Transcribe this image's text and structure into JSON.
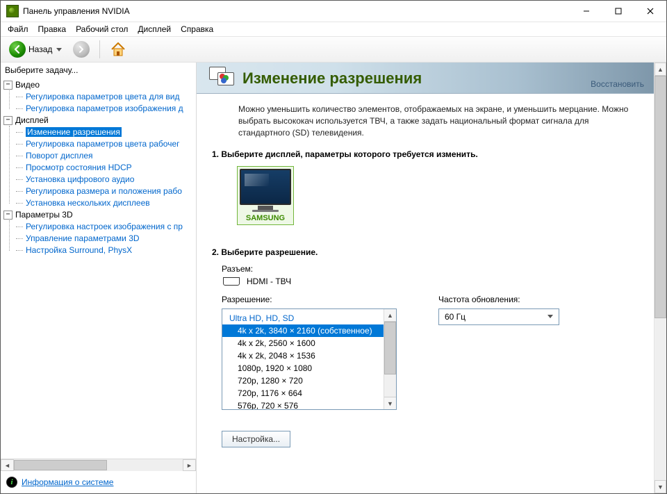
{
  "window": {
    "title": "Панель управления NVIDIA"
  },
  "menu": {
    "file": "Файл",
    "edit": "Правка",
    "desktop": "Рабочий стол",
    "display": "Дисплей",
    "help": "Справка"
  },
  "toolbar": {
    "back": "Назад"
  },
  "sidebar": {
    "header": "Выберите задачу...",
    "groups": [
      {
        "label": "Видео",
        "items": [
          "Регулировка параметров цвета для вид",
          "Регулировка параметров изображения д"
        ]
      },
      {
        "label": "Дисплей",
        "items": [
          "Изменение разрешения",
          "Регулировка параметров цвета рабочег",
          "Поворот дисплея",
          "Просмотр состояния HDCP",
          "Установка цифрового аудио",
          "Регулировка размера и положения рабо",
          "Установка нескольких дисплеев"
        ]
      },
      {
        "label": "Параметры 3D",
        "items": [
          "Регулировка настроек изображения с пр",
          "Управление параметрами 3D",
          "Настройка Surround, PhysX"
        ]
      }
    ],
    "sysinfo": "Информация о системе"
  },
  "page": {
    "title": "Изменение разрешения",
    "restore": "Восстановить",
    "description": "Можно уменьшить количество элементов, отображаемых на экране, и уменьшить мерцание. Можно выбрать высококач используется ТВЧ, а также задать национальный формат сигнала для стандартного (SD) телевидения.",
    "step1": "1. Выберите дисплей, параметры которого требуется изменить.",
    "display_name": "SAMSUNG",
    "step2": "2. Выберите разрешение.",
    "connector_label": "Разъем:",
    "connector_value": "HDMI - ТВЧ",
    "resolution_label": "Разрешение:",
    "refresh_label": "Частота обновления:",
    "refresh_value": "60 Гц",
    "res_group": "Ultra HD, HD, SD",
    "resolutions": [
      "4k x 2k, 3840 × 2160 (собственное)",
      "4k x 2k, 2560 × 1600",
      "4k x 2k, 2048 × 1536",
      "1080p, 1920 × 1080",
      "720p, 1280 × 720",
      "720p, 1176 × 664",
      "576p, 720 × 576"
    ],
    "customize": "Настройка..."
  }
}
